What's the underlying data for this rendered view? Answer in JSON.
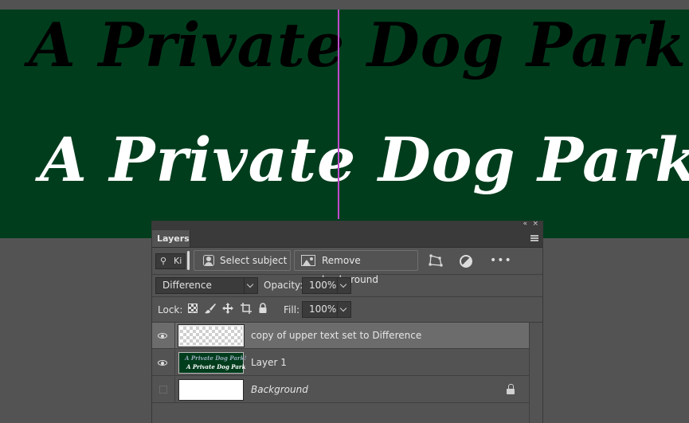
{
  "canvas": {
    "upper_text": "A Private Dog Park",
    "upper_bang": "!",
    "lower_text": "A Private Dog Park",
    "background_color": "#003d1d",
    "guide_color": "#c04ccc"
  },
  "panel": {
    "collapse_glyph": "«",
    "close_glyph": "×",
    "tab_label": "Layers",
    "filter_value": "Ki",
    "buttons": {
      "select_subject": "Select subject",
      "remove_background": "Remove background"
    },
    "more_glyph": "•••",
    "blend_mode": "Difference",
    "opacity_label": "Opacity:",
    "opacity_value": "100%",
    "lock_label": "Lock:",
    "fill_label": "Fill:",
    "fill_value": "100%",
    "layers": [
      {
        "name": "copy of upper text set to Difference",
        "visible": true,
        "selected": true,
        "thumb": "checker"
      },
      {
        "name": "Layer 1",
        "visible": true,
        "selected": false,
        "thumb": "green",
        "thumb_line1": "A Private Dog Park!",
        "thumb_line2": "A Private Dog Park"
      },
      {
        "name": "Background",
        "visible": false,
        "selected": false,
        "thumb": "white",
        "locked": true
      }
    ]
  }
}
